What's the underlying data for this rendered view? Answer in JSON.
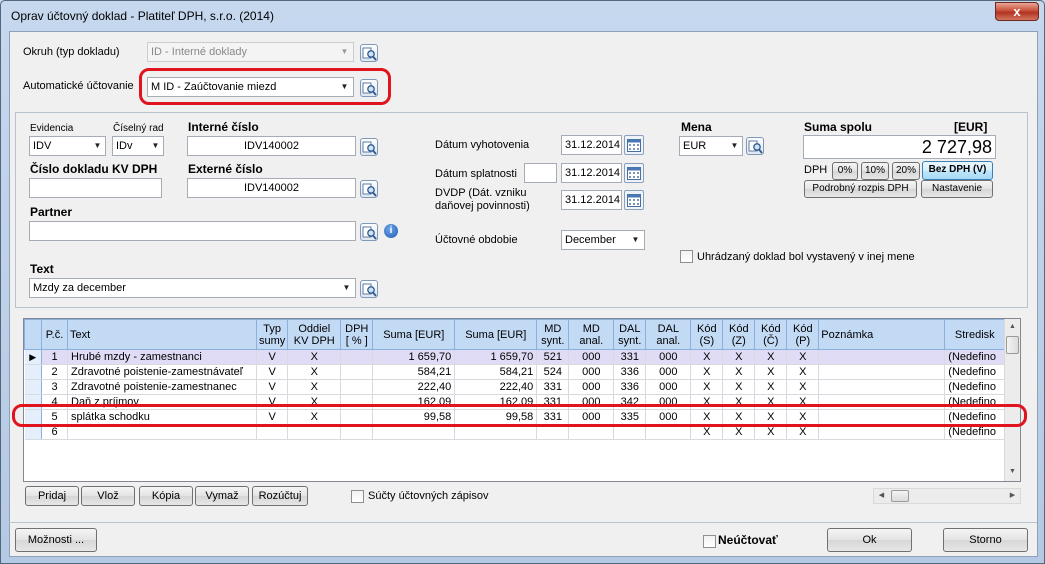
{
  "window": {
    "title": "Oprav účtovný doklad - Platiteľ DPH, s.r.o. (2014)",
    "close_label": "x"
  },
  "top": {
    "okruh_label": "Okruh (typ dokladu)",
    "okruh_value": "ID - Interné doklady",
    "auto_label": "Automatické účtovanie",
    "auto_value": "M ID - Zaúčtovanie miezd"
  },
  "doc": {
    "evidencia_label": "Evidencia",
    "evidencia_value": "IDV",
    "ciselny_label": "Číselný rad",
    "ciselny_value": "IDv",
    "interne_label": "Interné číslo",
    "interne_value": "IDV140002",
    "kv_label": "Číslo dokladu KV DPH",
    "kv_value": "",
    "externe_label": "Externé číslo",
    "externe_value": "IDV140002",
    "partner_label": "Partner",
    "partner_value": "",
    "text_label": "Text",
    "text_value": "Mzdy za december"
  },
  "dates": {
    "vyhotovenia_label": "Dátum vyhotovenia",
    "vyhotovenia_value": "31.12.2014",
    "splatnosti_label": "Dátum splatnosti",
    "splatnosti_days": "",
    "splatnosti_value": "31.12.2014",
    "dvdp_label_1": "DVDP (Dát. vzniku",
    "dvdp_label_2": "daňovej povinnosti)",
    "dvdp_value": "31.12.2014",
    "obdobie_label": "Účtovné obdobie",
    "obdobie_value": "December"
  },
  "currency": {
    "mena_label": "Mena",
    "mena_value": "EUR",
    "suma_label": "Suma spolu",
    "suma_unit": "[EUR]",
    "suma_value": "2 727,98",
    "dph_label": "DPH",
    "dph0": "0%",
    "dph10": "10%",
    "dph20": "20%",
    "bez_dph": "Bez DPH (V)",
    "rozpis": "Podrobný rozpis DPH",
    "nastavenie": "Nastavenie",
    "uhradzany": "Uhrádzaný doklad bol vystavený v inej mene"
  },
  "grid": {
    "headers": [
      "P.č.",
      "Text",
      "Typ\nsumy",
      "Oddiel\nKV DPH",
      "DPH\n[ % ]",
      "Suma [EUR]",
      "Suma [EUR]",
      "MD\nsynt.",
      "MD\nanal.",
      "DAL\nsynt.",
      "DAL\nanal.",
      "Kód\n(S)",
      "Kód\n(Z)",
      "Kód\n(Č)",
      "Kód\n(P)",
      "Poznámka",
      "Stredisk"
    ],
    "rows": [
      [
        "1",
        "Hrubé mzdy - zamestnanci",
        "V",
        "X",
        "",
        "1 659,70",
        "1 659,70",
        "521",
        "000",
        "331",
        "000",
        "X",
        "X",
        "X",
        "X",
        "",
        "(Nedefino"
      ],
      [
        "2",
        "Zdravotné poistenie-zamestnávateľ",
        "V",
        "X",
        "",
        "584,21",
        "584,21",
        "524",
        "000",
        "336",
        "000",
        "X",
        "X",
        "X",
        "X",
        "",
        "(Nedefino"
      ],
      [
        "3",
        "Zdravotné poistenie-zamestnanec",
        "V",
        "X",
        "",
        "222,40",
        "222,40",
        "331",
        "000",
        "336",
        "000",
        "X",
        "X",
        "X",
        "X",
        "",
        "(Nedefino"
      ],
      [
        "4",
        "Daň z príjmov",
        "V",
        "X",
        "",
        "162,09",
        "162,09",
        "331",
        "000",
        "342",
        "000",
        "X",
        "X",
        "X",
        "X",
        "",
        "(Nedefino"
      ],
      [
        "5",
        "splátka schodku",
        "V",
        "X",
        "",
        "99,58",
        "99,58",
        "331",
        "000",
        "335",
        "000",
        "X",
        "X",
        "X",
        "X",
        "",
        "(Nedefino"
      ],
      [
        "6",
        "",
        "",
        "",
        "",
        "",
        "",
        "",
        "",
        "",
        "",
        "X",
        "X",
        "X",
        "X",
        "",
        "(Nedefino"
      ]
    ]
  },
  "actions": {
    "pridaj": "Pridaj",
    "vloz": "Vlož",
    "kopia": "Kópia",
    "vymaz": "Vymaž",
    "rozuctuj": "Rozúčtuj",
    "sucty": "Súčty účtovných zápisov"
  },
  "footer": {
    "moznosti": "Možnosti ...",
    "neuctovat": "Neúčtovať",
    "ok": "Ok",
    "storno": "Storno"
  }
}
